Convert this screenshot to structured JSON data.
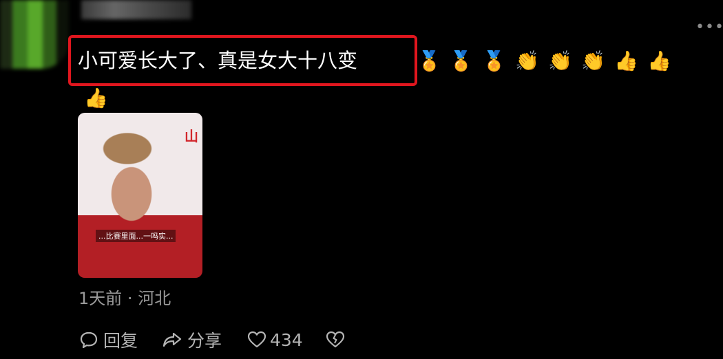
{
  "comment": {
    "text": "小可爱长大了、真是女大十八变",
    "emojis": [
      "🏅",
      "🏅",
      "🏅",
      "👏",
      "👏",
      "👏",
      "👍",
      "👍",
      "👍"
    ],
    "highlight_color": "#e0161e"
  },
  "more_icon": "more-horizontal-icon",
  "meta": {
    "time": "1天前",
    "separator": "·",
    "location": "河北"
  },
  "actions": {
    "reply_label": "回复",
    "share_label": "分享",
    "like_count": "434"
  },
  "thumbnail": {
    "brand_text": "山",
    "caption": "...比赛里面...一吗实..."
  },
  "colors": {
    "background": "#000000",
    "meta_text": "#9a9a9a",
    "action_text": "#b5b5b5"
  }
}
